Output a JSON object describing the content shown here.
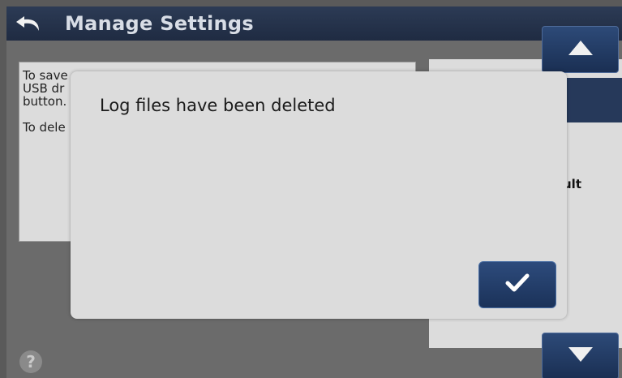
{
  "header": {
    "title": "Manage Settings",
    "back_icon": "back-arrow-icon"
  },
  "info_panel": {
    "line1": "To save",
    "line2": "USB dr",
    "line3": "button.",
    "line4": "To dele"
  },
  "right_list": {
    "visible_item": "ult"
  },
  "scroll": {
    "up_icon": "chevron-up-icon",
    "down_icon": "chevron-down-icon"
  },
  "help": {
    "icon": "help-icon",
    "glyph": "?"
  },
  "dialog": {
    "message": "Log files have been deleted",
    "ok_icon": "checkmark-icon"
  }
}
